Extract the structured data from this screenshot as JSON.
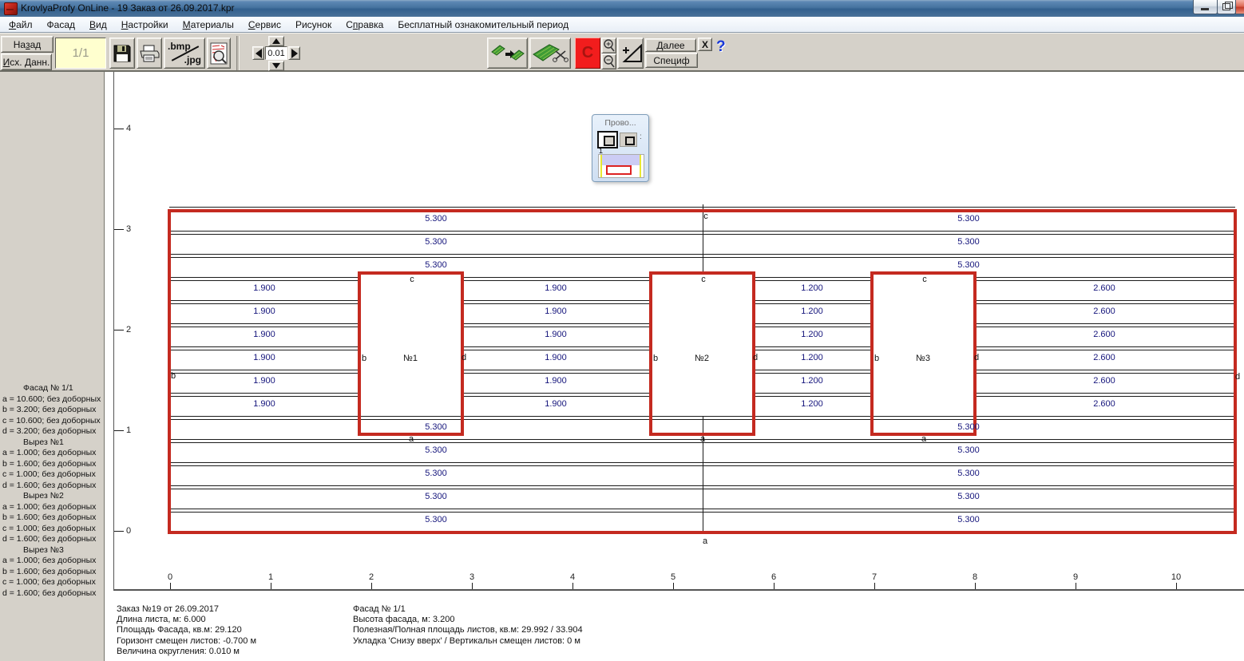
{
  "window": {
    "title": "KrovlyaProfy OnLine - 19 Заказ от 26.09.2017.kpr"
  },
  "menu": [
    {
      "pre": "",
      "accel": "Ф",
      "post": "айл"
    },
    {
      "pre": "Фасад",
      "accel": "",
      "post": ""
    },
    {
      "pre": "",
      "accel": "В",
      "post": "ид"
    },
    {
      "pre": "",
      "accel": "Н",
      "post": "астройки"
    },
    {
      "pre": "",
      "accel": "М",
      "post": "атериалы"
    },
    {
      "pre": "",
      "accel": "С",
      "post": "ервис"
    },
    {
      "pre": "Рисунок",
      "accel": "",
      "post": ""
    },
    {
      "pre": "С",
      "accel": "п",
      "post": "равка"
    },
    {
      "pre": "Бесплатный ознакомительный период",
      "accel": "",
      "post": ""
    }
  ],
  "toolbar": {
    "back": {
      "pre": "На",
      "accel": "з",
      "post": "ад"
    },
    "source_data": {
      "pre": "",
      "accel": "И",
      "post": "сх. Данн."
    },
    "page_field": "1/1",
    "bmp_label": ".bmp",
    "jpg_label": ".jpg",
    "step_value": "0.01",
    "c_button": "C",
    "next": {
      "pre": "",
      "accel": "Д",
      "post": "алее"
    },
    "spec": "Специф",
    "close_x": "X",
    "help": "?"
  },
  "palette": {
    "title": "Прово...",
    "badge": "1"
  },
  "sidebar": [
    "Фасад № 1/1",
    "a = 10.600; без доборных",
    "b = 3.200; без доборных",
    "c = 10.600; без доборных",
    "d = 3.200; без доборных",
    "Вырез №1",
    "a = 1.000; без доборных",
    "b = 1.600; без доборных",
    "c = 1.000; без доборных",
    "d = 1.600; без доборных",
    "Вырез №2",
    "a = 1.000; без доборных",
    "b = 1.600; без доборных",
    "c = 1.000; без доборных",
    "d = 1.600; без доборных",
    "Вырез №3",
    "a = 1.000; без доборных",
    "b = 1.600; без доборных",
    "c = 1.000; без доборных",
    "d = 1.600; без доборных"
  ],
  "status_left": [
    "Заказ №19 от 26.09.2017",
    "Длина листа, м: 6.000",
    "Площадь Фасада, кв.м:  29.120",
    "Горизонт смещен листов: -0.700 м",
    "Величина округления: 0.010 м"
  ],
  "status_right": [
    "Фасад № 1/1",
    "Высота фасада, м: 3.200",
    "Полезная/Полная площадь листов, кв.м:  29.992 / 33.904",
    "Укладка 'Снизу вверх' / Вертикальн смещен листов: 0 м"
  ],
  "diagram": {
    "axis_x": [
      "0",
      "1",
      "2",
      "3",
      "4",
      "5",
      "6",
      "7",
      "8",
      "9",
      "10"
    ],
    "axis_y": [
      "0",
      "1",
      "2",
      "3",
      "4"
    ],
    "rows_top": [
      [
        "5.300",
        "5.300"
      ],
      [
        "5.300",
        "5.300"
      ],
      [
        "5.300",
        "5.300"
      ]
    ],
    "rows_middle": [
      [
        "1.900",
        "1.900",
        "1.200",
        "2.600"
      ],
      [
        "1.900",
        "1.900",
        "1.200",
        "2.600"
      ],
      [
        "1.900",
        "1.900",
        "1.200",
        "2.600"
      ],
      [
        "1.900",
        "1.900",
        "1.200",
        "2.600"
      ],
      [
        "1.900",
        "1.900",
        "1.200",
        "2.600"
      ],
      [
        "1.900",
        "1.900",
        "1.200",
        "2.600"
      ]
    ],
    "rows_bottom": [
      [
        "5.300",
        "5.300"
      ],
      [
        "5.300",
        "5.300"
      ],
      [
        "5.300",
        "5.300"
      ],
      [
        "5.300",
        "5.300"
      ],
      [
        "5.300",
        "5.300"
      ]
    ],
    "cutouts": [
      {
        "name": "№1"
      },
      {
        "name": "№2"
      },
      {
        "name": "№3"
      }
    ],
    "cutout_letters": {
      "top": "c",
      "left": "b",
      "right": "d",
      "bottom": "a"
    },
    "facade_letters": {
      "top": "c",
      "left": "b",
      "right": "d",
      "bottom": "a"
    }
  }
}
